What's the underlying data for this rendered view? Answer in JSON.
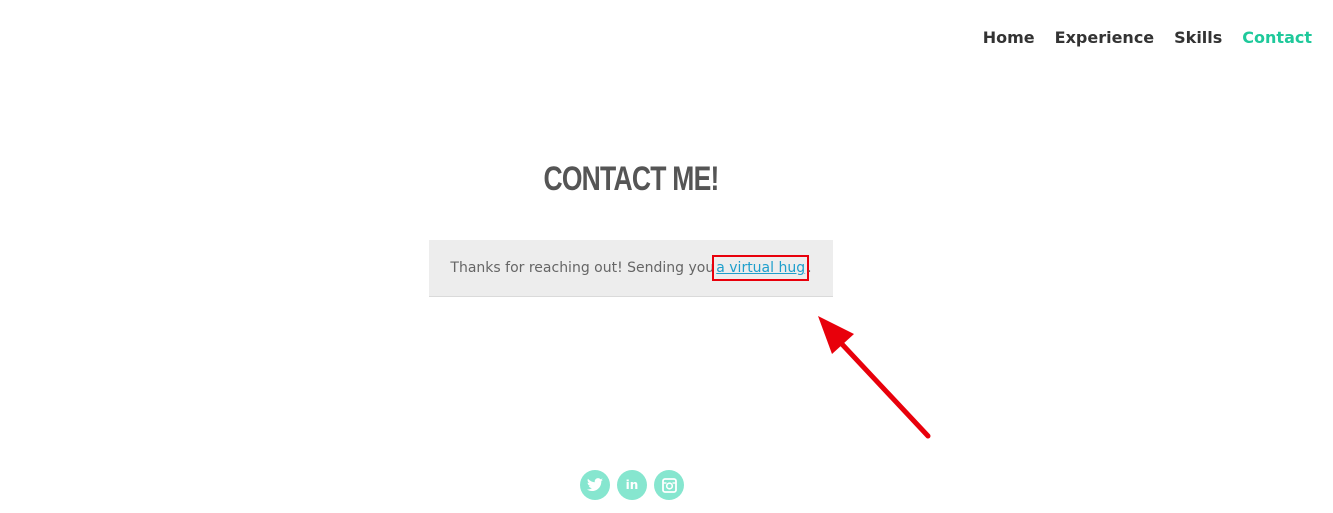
{
  "nav": {
    "items": [
      {
        "label": "Home"
      },
      {
        "label": "Experience"
      },
      {
        "label": "Skills"
      },
      {
        "label": "Contact"
      }
    ]
  },
  "page_title": "CONTACT ME!",
  "message": {
    "text_before": "Thanks for reaching out! Sending you",
    "link": "a virtual hug",
    "text_after": "."
  },
  "social": {
    "items": [
      {
        "icon": "twitter-icon"
      },
      {
        "icon": "linkedin-icon",
        "label": "in"
      },
      {
        "icon": "instagram-icon"
      }
    ]
  },
  "colors": {
    "accent": "#1fc99b",
    "social": "#86e6cf",
    "link": "#1e9fcc",
    "highlight": "#e8000b"
  }
}
